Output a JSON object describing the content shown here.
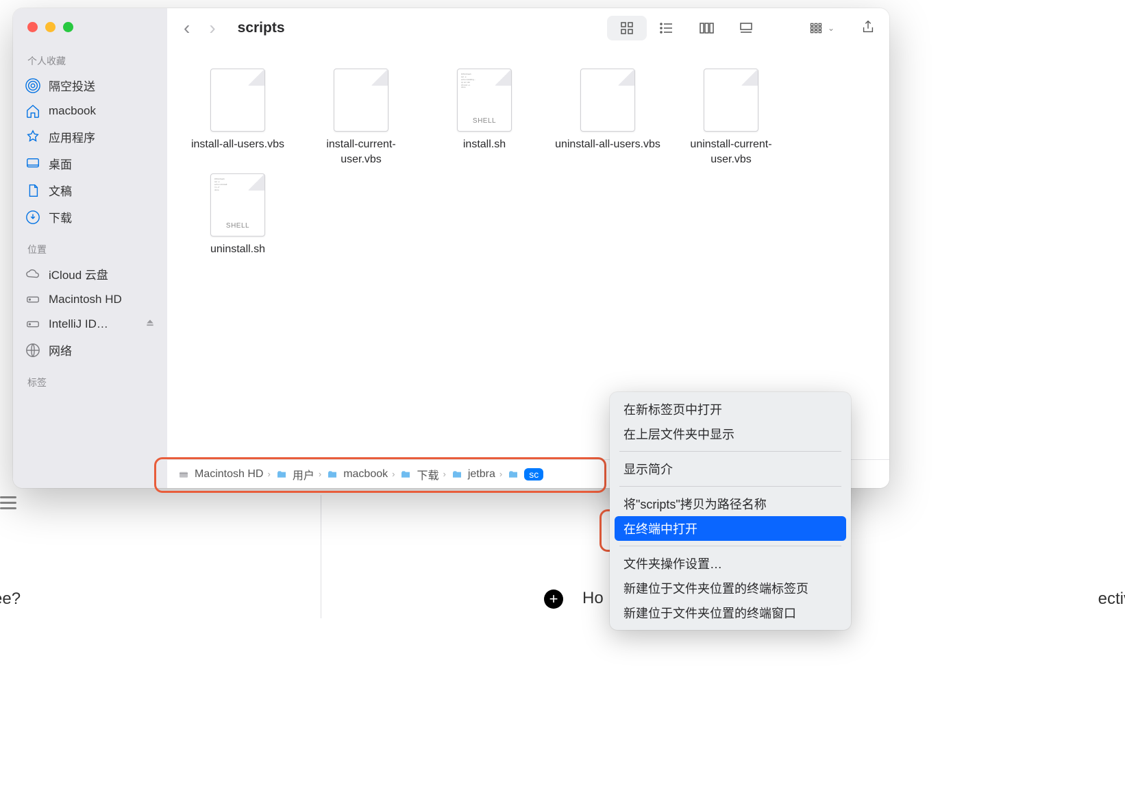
{
  "window_title": "scripts",
  "sidebar": {
    "favorites_label": "个人收藏",
    "items_fav": [
      {
        "label": "隔空投送",
        "icon": "airdrop"
      },
      {
        "label": "macbook",
        "icon": "home"
      },
      {
        "label": "应用程序",
        "icon": "apps"
      },
      {
        "label": "桌面",
        "icon": "desktop"
      },
      {
        "label": "文稿",
        "icon": "doc"
      },
      {
        "label": "下载",
        "icon": "download"
      }
    ],
    "locations_label": "位置",
    "items_loc": [
      {
        "label": "iCloud 云盘",
        "icon": "cloud"
      },
      {
        "label": "Macintosh HD",
        "icon": "hdd"
      },
      {
        "label": "IntelliJ ID…",
        "icon": "hdd",
        "eject": true
      },
      {
        "label": "网络",
        "icon": "globe"
      }
    ],
    "tags_label": "标签"
  },
  "files": [
    {
      "name": "install-all-users.vbs",
      "kind": "plain"
    },
    {
      "name": "install-current-user.vbs",
      "kind": "plain"
    },
    {
      "name": "install.sh",
      "kind": "shell"
    },
    {
      "name": "uninstall-all-users.vbs",
      "kind": "plain"
    },
    {
      "name": "uninstall-current-user.vbs",
      "kind": "plain"
    },
    {
      "name": "uninstall.sh",
      "kind": "shell"
    }
  ],
  "pathbar": [
    {
      "label": "Macintosh HD",
      "icon": "hdd"
    },
    {
      "label": "用户",
      "icon": "folder"
    },
    {
      "label": "macbook",
      "icon": "folder-home"
    },
    {
      "label": "下载",
      "icon": "folder"
    },
    {
      "label": "jetbra",
      "icon": "folder"
    },
    {
      "label": "sc",
      "icon": "folder",
      "pill": true
    }
  ],
  "context_menu": {
    "items": [
      "在新标签页中打开",
      "在上层文件夹中显示",
      "---",
      "显示简介",
      "---",
      "将\"scripts\"拷贝为路径名称",
      "在终端中打开",
      "---",
      "文件夹操作设置…",
      "新建位于文件夹位置的终端标签页",
      "新建位于文件夹位置的终端窗口"
    ],
    "highlighted_index": 6
  },
  "background": {
    "left_text": "ee?",
    "how_text": "Ho",
    "right_text": "ectiv"
  }
}
